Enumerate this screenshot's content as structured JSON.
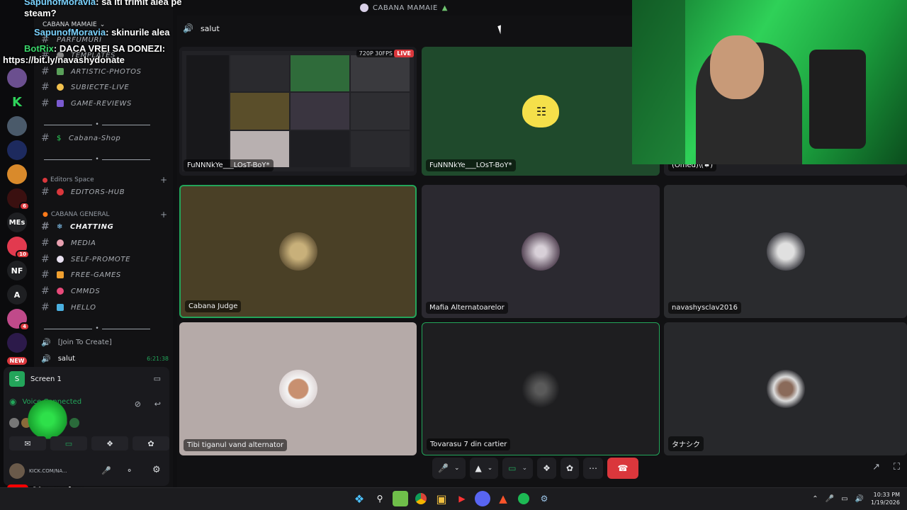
{
  "window": {
    "title": "CABANA MAMAIE"
  },
  "guilds": {
    "icons": [
      "K",
      "MEs",
      "NF",
      "A"
    ],
    "badges": [
      "6",
      "10",
      "4"
    ],
    "new_label": "NEW"
  },
  "sidebar": {
    "server_name": "CABANA MAMAIE",
    "categories": [
      "Editors Space",
      "CABANA GENERAL"
    ],
    "channels_top": [
      {
        "name": "PARFUMURI"
      },
      {
        "name": "TEMPLATES"
      },
      {
        "name": "ARTISTIC-PHOTOS"
      },
      {
        "name": "SUBIECTE-LIVE"
      },
      {
        "name": "GAME-REVIEWS"
      }
    ],
    "shop": "Cabana-Shop",
    "editors_hub": "EDITORS-HUB",
    "general_channels": [
      "CHATTING",
      "MEDIA",
      "SELF-PROMOTE",
      "FREE-GAMES",
      "CMMDS",
      "HELLO"
    ],
    "join_to_create": "[Join To Create]",
    "voice_channel": "salut",
    "voice_timer": "6:21:38"
  },
  "voice_panel": {
    "screen_label": "Screen 1",
    "status": "Voice Connected",
    "user_tag": "KICK.COM/NA..."
  },
  "main": {
    "channel_name": "salut",
    "stream_badge": "720P 30FPS",
    "live_badge": "LIVE",
    "tiles": [
      {
        "name": "FuNNNkYe___LOsT-BoY*"
      },
      {
        "name": "FuNNNkYe___LOsT-BoY*"
      },
      {
        "name": "(Omed)\\(♠)"
      },
      {
        "name": "Cabana Judge"
      },
      {
        "name": "Mafia Alternatoarelor"
      },
      {
        "name": "navashysclav2016"
      },
      {
        "name": "Tibi tiganul vand alternator"
      },
      {
        "name": "Tovarasu 7 din cartier"
      },
      {
        "name": "タナシク"
      }
    ]
  },
  "chat": {
    "lines": [
      {
        "user": "SapunofMoravia",
        "text": ": sa iti trimit alea pe steam?"
      },
      {
        "user": "SapunofMoravia",
        "text": ": skinurile alea"
      },
      {
        "user": "BotRix",
        "text": ": DACA VREI SA DONEZI: https://bit.ly/navashydonate"
      }
    ]
  },
  "brand": {
    "name": "Navashy"
  },
  "taskbar": {
    "time": "10:33 PM",
    "date": "1/19/2026"
  },
  "colors": {
    "accent_green": "#23a55a",
    "hangup_red": "#da373c",
    "live_red": "#da373c"
  }
}
